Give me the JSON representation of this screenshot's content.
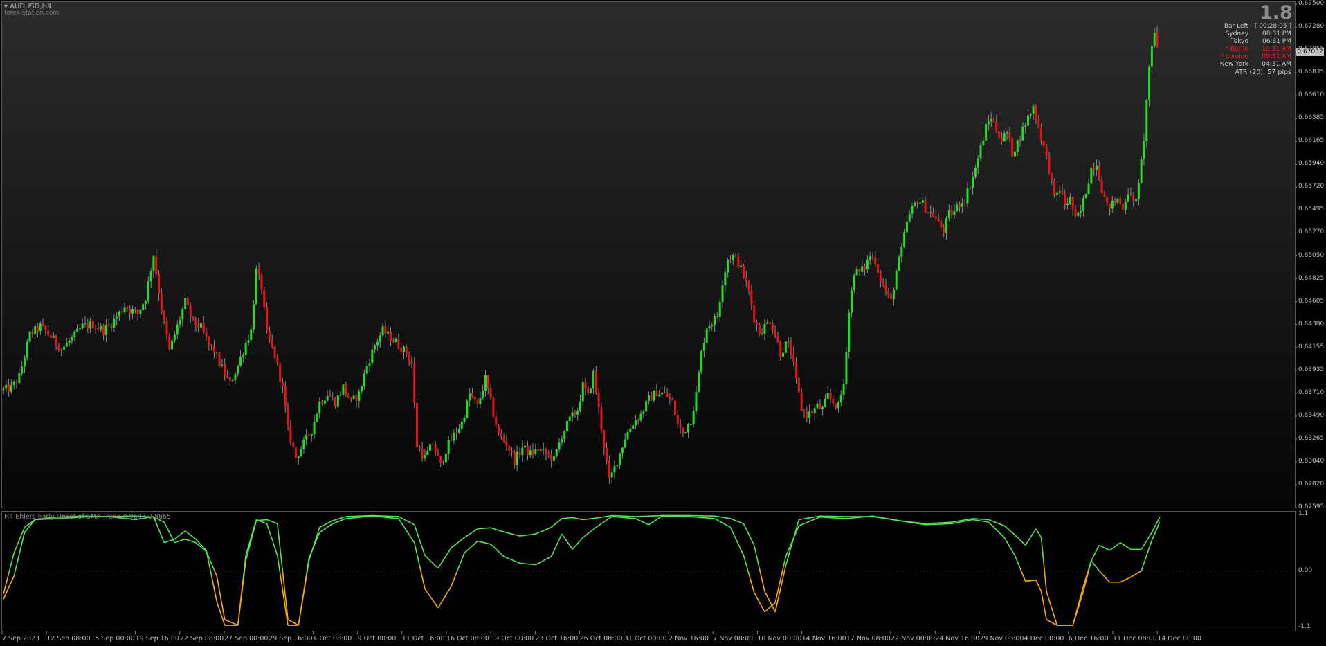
{
  "chart_title": "AUDUSD,H4",
  "watermark": "forex-station.com",
  "spread": "1.8",
  "info_panel": [
    {
      "label": "Bar Left",
      "value": "[ 00:28:05 ]",
      "color": "#c8c8c8"
    },
    {
      "label": "Sydney",
      "value": "08:31 PM",
      "color": "#c8c8c8"
    },
    {
      "label": "Tokyo",
      "value": "06:31 PM",
      "color": "#c8c8c8"
    },
    {
      "label": "* Berlin",
      "value": "10:31 AM",
      "color": "#ff1a1a"
    },
    {
      "label": "* London",
      "value": "09:31 AM",
      "color": "#ff1a1a"
    },
    {
      "label": "New York",
      "value": "04:31 AM",
      "color": "#c8c8c8"
    }
  ],
  "atr_text": "ATR (20): 57 pips",
  "current_price": "0.67032",
  "price_axis": [
    "0.67500",
    "0.67280",
    "0.67055",
    "0.66835",
    "0.66610",
    "0.66385",
    "0.66165",
    "0.65940",
    "0.65720",
    "0.65495",
    "0.65270",
    "0.65050",
    "0.64825",
    "0.64605",
    "0.64380",
    "0.64155",
    "0.63935",
    "0.63710",
    "0.63490",
    "0.63265",
    "0.63040",
    "0.62820",
    "0.62595"
  ],
  "indicator": {
    "title": "H4 Ehlers Early Onset of SMA Trend 0.9693 0.8865",
    "axis": [
      "1.1",
      "0.00",
      "-1.1"
    ]
  },
  "time_axis": [
    "7 Sep 2023",
    "12 Sep 08:00",
    "15 Sep 00:00",
    "19 Sep 16:00",
    "22 Sep 08:00",
    "27 Sep 00:00",
    "29 Sep 16:00",
    "4 Oct 08:00",
    "9 Oct 00:00",
    "11 Oct 16:00",
    "16 Oct 08:00",
    "19 Oct 00:00",
    "23 Oct 16:00",
    "26 Oct 08:00",
    "31 Oct 00:00",
    "2 Nov 16:00",
    "7 Nov 08:00",
    "10 Nov 00:00",
    "14 Nov 16:00",
    "17 Nov 08:00",
    "22 Nov 00:00",
    "24 Nov 16:00",
    "29 Nov 08:00",
    "4 Dec 00:00",
    "6 Dec 16:00",
    "11 Dec 08:00",
    "14 Dec 00:00"
  ],
  "colors": {
    "bull": "#22dd22",
    "bear": "#ee1111",
    "ind_up": "#55e655",
    "ind_down": "#ffaa00"
  },
  "chart_data": {
    "type": "candlestick",
    "symbol": "AUDUSD",
    "timeframe": "H4",
    "ylim": [
      0.62595,
      0.675
    ],
    "close_path": [
      [
        0,
        0.6374
      ],
      [
        3,
        0.6376
      ],
      [
        6,
        0.6387
      ],
      [
        10,
        0.6428
      ],
      [
        14,
        0.6436
      ],
      [
        18,
        0.6426
      ],
      [
        22,
        0.6414
      ],
      [
        26,
        0.6424
      ],
      [
        30,
        0.6436
      ],
      [
        34,
        0.6438
      ],
      [
        38,
        0.6432
      ],
      [
        42,
        0.6442
      ],
      [
        46,
        0.6456
      ],
      [
        48,
        0.6452
      ],
      [
        51,
        0.6448
      ],
      [
        54,
        0.6464
      ],
      [
        57,
        0.6506
      ],
      [
        60,
        0.6452
      ],
      [
        63,
        0.6412
      ],
      [
        66,
        0.6436
      ],
      [
        69,
        0.646
      ],
      [
        72,
        0.644
      ],
      [
        75,
        0.6435
      ],
      [
        78,
        0.6418
      ],
      [
        80,
        0.6412
      ],
      [
        83,
        0.6395
      ],
      [
        86,
        0.638
      ],
      [
        89,
        0.6398
      ],
      [
        92,
        0.642
      ],
      [
        94,
        0.6432
      ],
      [
        96,
        0.649
      ],
      [
        98,
        0.6474
      ],
      [
        100,
        0.6428
      ],
      [
        103,
        0.6408
      ],
      [
        106,
        0.6375
      ],
      [
        108,
        0.6335
      ],
      [
        111,
        0.6308
      ],
      [
        114,
        0.6322
      ],
      [
        117,
        0.6335
      ],
      [
        120,
        0.6362
      ],
      [
        123,
        0.637
      ],
      [
        126,
        0.6362
      ],
      [
        129,
        0.6377
      ],
      [
        132,
        0.6362
      ],
      [
        135,
        0.637
      ],
      [
        138,
        0.6398
      ],
      [
        141,
        0.6418
      ],
      [
        144,
        0.6432
      ],
      [
        147,
        0.6425
      ],
      [
        150,
        0.6418
      ],
      [
        153,
        0.641
      ],
      [
        155,
        0.64
      ],
      [
        157,
        0.632
      ],
      [
        160,
        0.6308
      ],
      [
        163,
        0.6322
      ],
      [
        166,
        0.63
      ],
      [
        168,
        0.6316
      ],
      [
        171,
        0.633
      ],
      [
        174,
        0.6342
      ],
      [
        177,
        0.637
      ],
      [
        180,
        0.6358
      ],
      [
        183,
        0.6385
      ],
      [
        185,
        0.6362
      ],
      [
        188,
        0.633
      ],
      [
        191,
        0.6322
      ],
      [
        194,
        0.6305
      ],
      [
        197,
        0.6318
      ],
      [
        200,
        0.6312
      ],
      [
        203,
        0.6316
      ],
      [
        206,
        0.6312
      ],
      [
        209,
        0.6306
      ],
      [
        212,
        0.633
      ],
      [
        215,
        0.6345
      ],
      [
        218,
        0.6355
      ],
      [
        220,
        0.6378
      ],
      [
        222,
        0.6368
      ],
      [
        224,
        0.639
      ],
      [
        226,
        0.6355
      ],
      [
        228,
        0.632
      ],
      [
        230,
        0.6285
      ],
      [
        233,
        0.6305
      ],
      [
        236,
        0.6328
      ],
      [
        239,
        0.6342
      ],
      [
        242,
        0.635
      ],
      [
        245,
        0.6365
      ],
      [
        248,
        0.6372
      ],
      [
        251,
        0.637
      ],
      [
        254,
        0.6362
      ],
      [
        256,
        0.634
      ],
      [
        258,
        0.6332
      ],
      [
        261,
        0.6345
      ],
      [
        263,
        0.637
      ],
      [
        265,
        0.641
      ],
      [
        267,
        0.6436
      ],
      [
        269,
        0.644
      ],
      [
        271,
        0.6446
      ],
      [
        273,
        0.648
      ],
      [
        275,
        0.6502
      ],
      [
        277,
        0.6504
      ],
      [
        279,
        0.6498
      ],
      [
        281,
        0.6485
      ],
      [
        283,
        0.647
      ],
      [
        285,
        0.6444
      ],
      [
        287,
        0.643
      ],
      [
        289,
        0.6436
      ],
      [
        291,
        0.6442
      ],
      [
        293,
        0.6428
      ],
      [
        295,
        0.641
      ],
      [
        297,
        0.6418
      ],
      [
        299,
        0.6412
      ],
      [
        301,
        0.6382
      ],
      [
        303,
        0.6356
      ],
      [
        305,
        0.635
      ],
      [
        307,
        0.6353
      ],
      [
        309,
        0.6358
      ],
      [
        311,
        0.6355
      ],
      [
        313,
        0.6368
      ],
      [
        315,
        0.6362
      ],
      [
        317,
        0.6358
      ],
      [
        319,
        0.638
      ],
      [
        321,
        0.645
      ],
      [
        323,
        0.649
      ],
      [
        325,
        0.6488
      ],
      [
        327,
        0.6494
      ],
      [
        329,
        0.6505
      ],
      [
        331,
        0.65
      ],
      [
        333,
        0.6482
      ],
      [
        335,
        0.647
      ],
      [
        337,
        0.646
      ],
      [
        339,
        0.649
      ],
      [
        341,
        0.651
      ],
      [
        343,
        0.6538
      ],
      [
        345,
        0.655
      ],
      [
        347,
        0.656
      ],
      [
        349,
        0.6555
      ],
      [
        351,
        0.6548
      ],
      [
        353,
        0.6545
      ],
      [
        355,
        0.6536
      ],
      [
        357,
        0.653
      ],
      [
        359,
        0.6545
      ],
      [
        361,
        0.6548
      ],
      [
        363,
        0.6556
      ],
      [
        365,
        0.656
      ],
      [
        367,
        0.6575
      ],
      [
        369,
        0.659
      ],
      [
        371,
        0.661
      ],
      [
        373,
        0.663
      ],
      [
        375,
        0.664
      ],
      [
        377,
        0.6628
      ],
      [
        379,
        0.6618
      ],
      [
        381,
        0.6625
      ],
      [
        383,
        0.6605
      ],
      [
        385,
        0.6615
      ],
      [
        387,
        0.6628
      ],
      [
        389,
        0.664
      ],
      [
        391,
        0.665
      ],
      [
        393,
        0.663
      ],
      [
        395,
        0.661
      ],
      [
        397,
        0.659
      ],
      [
        399,
        0.656
      ],
      [
        401,
        0.657
      ],
      [
        403,
        0.6555
      ],
      [
        405,
        0.656
      ],
      [
        407,
        0.654
      ],
      [
        409,
        0.6548
      ],
      [
        411,
        0.6568
      ],
      [
        413,
        0.659
      ],
      [
        415,
        0.6595
      ],
      [
        417,
        0.657
      ],
      [
        419,
        0.6552
      ],
      [
        421,
        0.6555
      ],
      [
        423,
        0.656
      ],
      [
        425,
        0.6552
      ],
      [
        427,
        0.6568
      ],
      [
        429,
        0.6555
      ],
      [
        431,
        0.6572
      ],
      [
        433,
        0.662
      ],
      [
        435,
        0.669
      ],
      [
        437,
        0.672
      ],
      [
        438,
        0.671
      ]
    ],
    "indicator": {
      "name": "Ehlers Early Onset of SMA Trend",
      "ylim": [
        -1.1,
        1.1
      ],
      "fast_path": [
        [
          0,
          -0.55
        ],
        [
          4,
          -0.1
        ],
        [
          8,
          0.75
        ],
        [
          12,
          1.0
        ],
        [
          20,
          1.02
        ],
        [
          30,
          1.05
        ],
        [
          40,
          1.06
        ],
        [
          50,
          1.0
        ],
        [
          57,
          1.06
        ],
        [
          61,
          0.55
        ],
        [
          65,
          0.62
        ],
        [
          69,
          0.78
        ],
        [
          73,
          0.62
        ],
        [
          77,
          0.4
        ],
        [
          81,
          -0.6
        ],
        [
          84,
          -1.06
        ],
        [
          89,
          -1.06
        ],
        [
          92,
          0.3
        ],
        [
          96,
          1.0
        ],
        [
          100,
          0.92
        ],
        [
          104,
          0.3
        ],
        [
          108,
          -1.06
        ],
        [
          112,
          -1.06
        ],
        [
          116,
          0.25
        ],
        [
          120,
          0.75
        ],
        [
          125,
          0.92
        ],
        [
          130,
          1.02
        ],
        [
          140,
          1.07
        ],
        [
          150,
          1.02
        ],
        [
          156,
          0.55
        ],
        [
          160,
          -0.35
        ],
        [
          165,
          -0.72
        ],
        [
          170,
          -0.3
        ],
        [
          175,
          0.35
        ],
        [
          180,
          0.58
        ],
        [
          185,
          0.52
        ],
        [
          190,
          0.28
        ],
        [
          196,
          0.15
        ],
        [
          202,
          0.12
        ],
        [
          208,
          0.28
        ],
        [
          212,
          0.72
        ],
        [
          216,
          0.42
        ],
        [
          220,
          0.65
        ],
        [
          225,
          0.85
        ],
        [
          231,
          1.06
        ],
        [
          240,
          1.02
        ],
        [
          245,
          0.9
        ],
        [
          250,
          1.07
        ],
        [
          260,
          1.06
        ],
        [
          270,
          1.02
        ],
        [
          276,
          0.85
        ],
        [
          281,
          0.3
        ],
        [
          285,
          -0.42
        ],
        [
          289,
          -0.8
        ],
        [
          293,
          -0.62
        ],
        [
          297,
          0.28
        ],
        [
          302,
          0.88
        ],
        [
          310,
          1.05
        ],
        [
          320,
          1.02
        ],
        [
          330,
          1.07
        ],
        [
          340,
          0.98
        ],
        [
          350,
          0.9
        ],
        [
          360,
          0.92
        ],
        [
          368,
          1.0
        ],
        [
          374,
          0.95
        ],
        [
          380,
          0.65
        ],
        [
          384,
          0.3
        ],
        [
          388,
          -0.2
        ],
        [
          392,
          -0.18
        ],
        [
          394,
          -0.4
        ],
        [
          396,
          -0.95
        ],
        [
          400,
          -1.06
        ],
        [
          406,
          -1.06
        ],
        [
          410,
          -0.4
        ],
        [
          413,
          0.2
        ],
        [
          416,
          0.0
        ],
        [
          420,
          -0.22
        ],
        [
          424,
          -0.22
        ],
        [
          428,
          -0.12
        ],
        [
          432,
          0.0
        ],
        [
          436,
          0.6
        ],
        [
          439,
          0.95
        ]
      ],
      "slow_path": [
        [
          0,
          -0.45
        ],
        [
          4,
          0.35
        ],
        [
          8,
          0.85
        ],
        [
          12,
          1.0
        ],
        [
          20,
          1.05
        ],
        [
          30,
          1.07
        ],
        [
          40,
          1.06
        ],
        [
          50,
          1.07
        ],
        [
          57,
          1.05
        ],
        [
          61,
          0.95
        ],
        [
          65,
          0.55
        ],
        [
          69,
          0.62
        ],
        [
          73,
          0.55
        ],
        [
          77,
          0.38
        ],
        [
          81,
          -0.1
        ],
        [
          84,
          -0.95
        ],
        [
          89,
          -1.06
        ],
        [
          92,
          0.2
        ],
        [
          96,
          0.98
        ],
        [
          100,
          1.0
        ],
        [
          104,
          0.92
        ],
        [
          108,
          -0.95
        ],
        [
          112,
          -1.06
        ],
        [
          116,
          0.2
        ],
        [
          120,
          0.85
        ],
        [
          125,
          0.98
        ],
        [
          130,
          1.06
        ],
        [
          140,
          1.08
        ],
        [
          150,
          1.06
        ],
        [
          156,
          0.9
        ],
        [
          160,
          0.3
        ],
        [
          165,
          0.05
        ],
        [
          170,
          0.45
        ],
        [
          175,
          0.65
        ],
        [
          180,
          0.82
        ],
        [
          185,
          0.84
        ],
        [
          190,
          0.76
        ],
        [
          196,
          0.68
        ],
        [
          202,
          0.72
        ],
        [
          208,
          0.85
        ],
        [
          212,
          1.02
        ],
        [
          216,
          1.04
        ],
        [
          220,
          1.0
        ],
        [
          225,
          1.03
        ],
        [
          231,
          1.08
        ],
        [
          240,
          1.06
        ],
        [
          245,
          1.07
        ],
        [
          250,
          1.08
        ],
        [
          260,
          1.08
        ],
        [
          270,
          1.07
        ],
        [
          276,
          1.02
        ],
        [
          281,
          0.92
        ],
        [
          285,
          0.5
        ],
        [
          289,
          -0.4
        ],
        [
          293,
          -0.8
        ],
        [
          297,
          0.1
        ],
        [
          302,
          1.0
        ],
        [
          310,
          1.07
        ],
        [
          320,
          1.06
        ],
        [
          330,
          1.06
        ],
        [
          340,
          0.98
        ],
        [
          350,
          0.92
        ],
        [
          360,
          0.95
        ],
        [
          368,
          1.02
        ],
        [
          374,
          1.0
        ],
        [
          380,
          0.88
        ],
        [
          384,
          0.7
        ],
        [
          388,
          0.5
        ],
        [
          392,
          0.82
        ],
        [
          394,
          0.65
        ],
        [
          396,
          -0.4
        ],
        [
          400,
          -1.06
        ],
        [
          406,
          -1.06
        ],
        [
          410,
          -0.3
        ],
        [
          413,
          0.2
        ],
        [
          416,
          0.5
        ],
        [
          420,
          0.4
        ],
        [
          424,
          0.55
        ],
        [
          428,
          0.42
        ],
        [
          432,
          0.42
        ],
        [
          436,
          0.75
        ],
        [
          439,
          1.05
        ]
      ]
    }
  }
}
